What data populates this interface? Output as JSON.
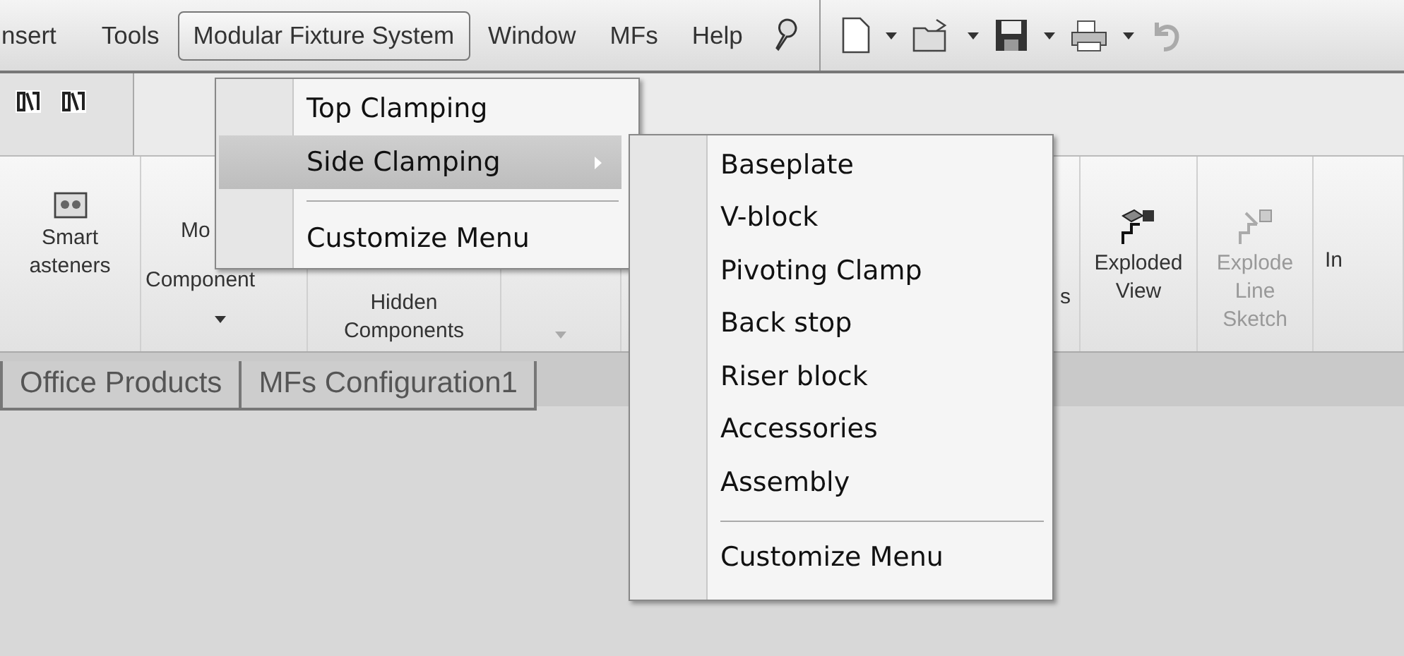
{
  "menubar": {
    "items": [
      {
        "label": "nsert",
        "selected": false
      },
      {
        "label": "Tools",
        "selected": false
      },
      {
        "label": "Modular Fixture System",
        "selected": true
      },
      {
        "label": "Window",
        "selected": false
      },
      {
        "label": "MFs",
        "selected": false
      },
      {
        "label": "Help",
        "selected": false
      }
    ]
  },
  "ribbon": {
    "buttons": [
      {
        "kind": "fasteners",
        "lines": [
          "Smart",
          "asteners"
        ],
        "disabled": false
      },
      {
        "kind": "move",
        "lines": [
          "Mo",
          "Component"
        ],
        "dropdown": true,
        "disabled": false
      },
      {
        "kind": "plain",
        "lines": [
          "Hidden",
          "Components"
        ],
        "disabled": false
      },
      {
        "kind": "plain",
        "dropdown": true,
        "disabled": true
      },
      {
        "kind": "plain",
        "lines": [
          "s"
        ],
        "disabled": false
      },
      {
        "kind": "exploded",
        "lines": [
          "Exploded",
          "View"
        ],
        "disabled": false
      },
      {
        "kind": "explode-line",
        "lines": [
          "Explode",
          "Line",
          "Sketch"
        ],
        "disabled": true
      },
      {
        "kind": "plain",
        "lines": [
          "In"
        ],
        "disabled": false
      }
    ]
  },
  "tabs": [
    {
      "label": "Office Products",
      "selected": false
    },
    {
      "label": "MFs Configuration1",
      "selected": false
    }
  ],
  "menu": {
    "items": [
      {
        "kind": "item",
        "label": "Top Clamping",
        "selected": false
      },
      {
        "kind": "item",
        "label": "Side Clamping",
        "selected": true,
        "submenu": true
      },
      {
        "kind": "separator"
      },
      {
        "kind": "item",
        "label": "Customize Menu",
        "selected": false
      }
    ]
  },
  "submenu": {
    "items": [
      {
        "kind": "item",
        "label": "Baseplate",
        "selected": false
      },
      {
        "kind": "item",
        "label": "V-block",
        "selected": false
      },
      {
        "kind": "item",
        "label": "Pivoting Clamp",
        "selected": false
      },
      {
        "kind": "item",
        "label": "Back stop",
        "selected": false
      },
      {
        "kind": "item",
        "label": "Riser block",
        "selected": false
      },
      {
        "kind": "item",
        "label": "Accessories",
        "selected": false
      },
      {
        "kind": "item",
        "label": "Assembly",
        "selected": false
      },
      {
        "kind": "separator"
      },
      {
        "kind": "item",
        "label": "Customize Menu",
        "selected": false
      }
    ]
  }
}
